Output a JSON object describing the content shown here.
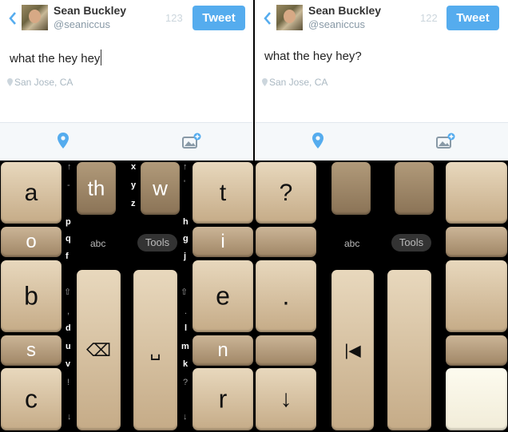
{
  "left": {
    "user": {
      "name": "Sean Buckley",
      "handle": "@seaniccus"
    },
    "char_count": "123",
    "tweet_button": "Tweet",
    "text": "what the hey hey",
    "location": "San Jose, CA",
    "keyboard": {
      "abc": "abc",
      "tools": "Tools",
      "keys": {
        "a": "a",
        "o": "o",
        "b": "b",
        "s": "s",
        "c": "c",
        "th": "th",
        "w": "w",
        "t": "t",
        "i": "i",
        "e": "e",
        "n": "n",
        "r": "r",
        "backspace": "⌫",
        "space": "␣"
      },
      "hints": {
        "x": "x",
        "y": "y",
        "z": "z",
        "p": "p",
        "q": "q",
        "f": "f",
        "d": "d",
        "u": "u",
        "v": "v",
        "h": "h",
        "g": "g",
        "j": "j",
        "l": "l",
        "m": "m",
        "k": "k",
        "dash": "-",
        "apostrophe": "'",
        "period": ".",
        "exclamation": "!",
        "question": "?",
        "up1": "↑",
        "up2": "↑",
        "down1": "↓",
        "down2": "↓",
        "shift1": "⇧",
        "shift2": "⇧",
        "comma": ","
      }
    }
  },
  "right": {
    "user": {
      "name": "Sean Buckley",
      "handle": "@seaniccus"
    },
    "char_count": "122",
    "tweet_button": "Tweet",
    "text": "what the hey hey?",
    "location": "San Jose, CA",
    "keyboard": {
      "abc": "abc",
      "tools": "Tools",
      "keys": {
        "question": "?",
        "period": ".",
        "down": "↓",
        "rewind": "|◀"
      }
    }
  }
}
